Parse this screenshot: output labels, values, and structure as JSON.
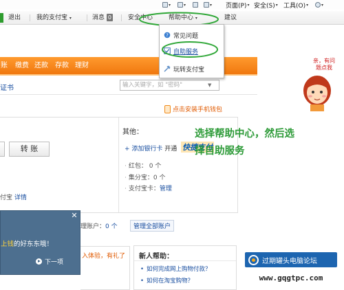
{
  "ie_toolbar": {
    "page_label": "页面(P)",
    "safety_label": "安全(S)",
    "tools_label": "工具(O)"
  },
  "topnav": {
    "logout": "退出",
    "my_alipay": "我的支付宝",
    "messages_label": "消息",
    "messages_count": "0",
    "security_center": "安全中心",
    "help_center": "帮助中心",
    "suggestion": "建议"
  },
  "help_dropdown": {
    "items": [
      {
        "label": "常见问题",
        "icon": "question-icon"
      },
      {
        "label": "自助服务",
        "icon": "checkbox-icon"
      },
      {
        "label": "玩转支付宝",
        "icon": "tool-icon"
      }
    ]
  },
  "orange_nav": {
    "items": [
      "账",
      "缴费",
      "还款",
      "存款",
      "理财"
    ]
  },
  "sub_row": {
    "certificate_link": "证书",
    "search_placeholder": "输入关键字，如 \"密码\""
  },
  "mobile_wallet_link": "点击安装手机钱包",
  "side_promo": {
    "line1": "亲，有问",
    "line2": "题点我"
  },
  "annotation": {
    "line1": "选择帮助中心，然后选",
    "line2": "择自助服务"
  },
  "main_box": {
    "transfer_button": "转 账",
    "alipay_text": "付宝",
    "detail_link": "详情",
    "other_title": "其他：",
    "add_card_text": "+ 添加银行卡",
    "open_text": "开通",
    "quickpay_logo": "快捷支付",
    "red_packet_label": "红包：",
    "red_packet_value": "0 个",
    "jifen_label": "集分宝：",
    "jifen_value": "0 个",
    "card_label": "支付宝卡：",
    "card_link": "管理"
  },
  "accounts": {
    "label": "理账户：",
    "value": "0 个",
    "manage_button": "管理全部账户"
  },
  "popup": {
    "text_highlight": "上钱",
    "text_rest": "的好东东哦！",
    "next_label": "下一项"
  },
  "gift_panel": {
    "text": "入体验，有礼了"
  },
  "help_panel": {
    "title": "新人帮助：",
    "items": [
      "如何完成网上购物付款？",
      "如何在淘宝购物？"
    ]
  },
  "watermark": {
    "text": "过期罐头电脑论坛",
    "url": "www.gqgtpc.com"
  }
}
